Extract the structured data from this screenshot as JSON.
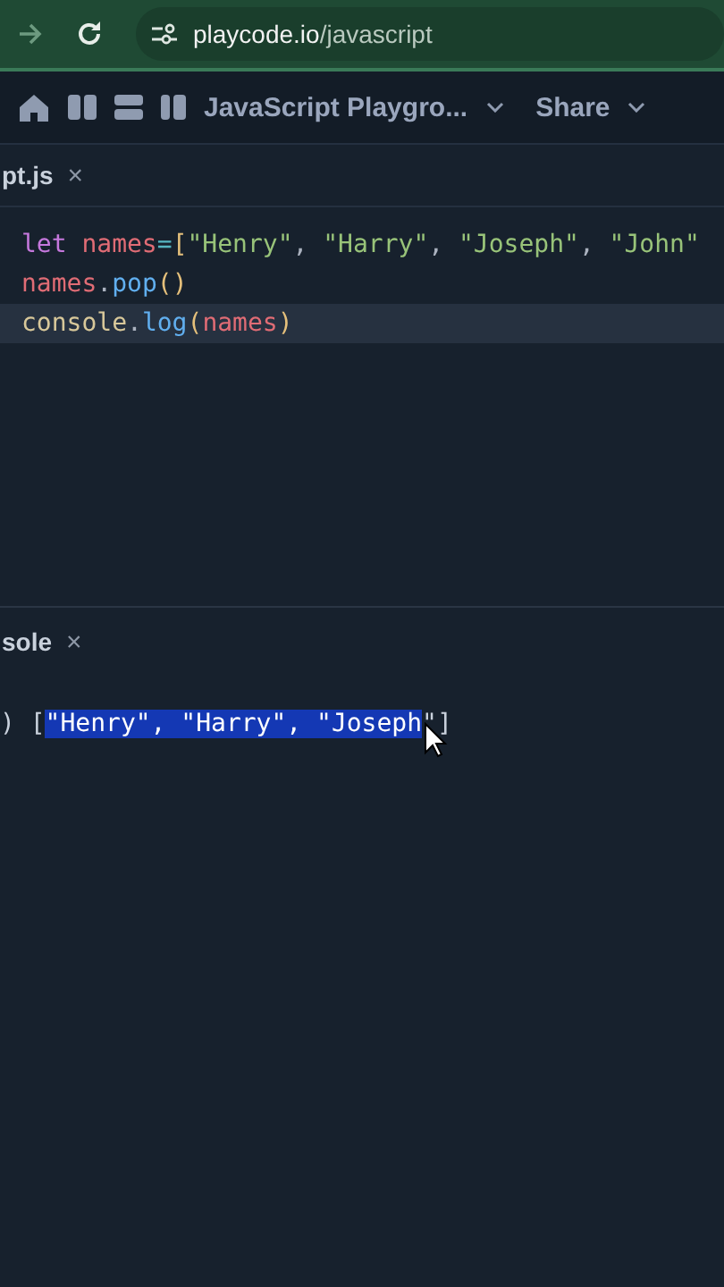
{
  "browser": {
    "url_host": "playcode.io",
    "url_path": "/javascript"
  },
  "toolbar": {
    "project_title": "JavaScript Playgro...",
    "share": "Share"
  },
  "editor_tab": {
    "label": "pt.js",
    "close": "×"
  },
  "code_lines": [
    {
      "current": false,
      "tokens": [
        {
          "kind": "keyword",
          "text": "let "
        },
        {
          "kind": "variable",
          "text": "names"
        },
        {
          "kind": "operator",
          "text": "="
        },
        {
          "kind": "bracket",
          "text": "["
        },
        {
          "kind": "string",
          "text": "\"Henry\""
        },
        {
          "kind": "punct",
          "text": ", "
        },
        {
          "kind": "string",
          "text": "\"Harry\""
        },
        {
          "kind": "punct",
          "text": ", "
        },
        {
          "kind": "string",
          "text": "\"Joseph\""
        },
        {
          "kind": "punct",
          "text": ", "
        },
        {
          "kind": "string",
          "text": "\"John\""
        }
      ]
    },
    {
      "current": false,
      "tokens": [
        {
          "kind": "variable",
          "text": "names"
        },
        {
          "kind": "punct",
          "text": "."
        },
        {
          "kind": "function",
          "text": "pop"
        },
        {
          "kind": "bracket",
          "text": "()"
        }
      ]
    },
    {
      "current": true,
      "tokens": [
        {
          "kind": "object",
          "text": "console"
        },
        {
          "kind": "punct",
          "text": "."
        },
        {
          "kind": "function",
          "text": "log"
        },
        {
          "kind": "bracket",
          "text": "("
        },
        {
          "kind": "variable",
          "text": "names"
        },
        {
          "kind": "bracket",
          "text": ")"
        }
      ]
    }
  ],
  "console_tab": {
    "label": "sole",
    "close": "×"
  },
  "console_output": [
    {
      "text": ") [",
      "selected": false
    },
    {
      "text": "\"Henry\", \"Harry\", \"Joseph",
      "selected": true
    },
    {
      "text": "\"]",
      "selected": false
    }
  ]
}
